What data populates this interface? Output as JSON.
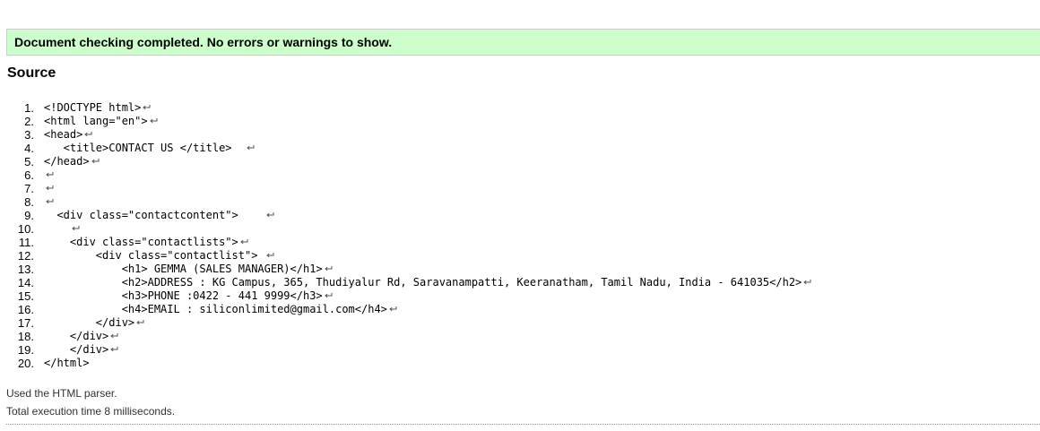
{
  "banner": {
    "message": "Document checking completed. No errors or warnings to show."
  },
  "source": {
    "heading": "Source",
    "lines": [
      {
        "number": "1.",
        "code": "<!DOCTYPE html>",
        "return_mark": true
      },
      {
        "number": "2.",
        "code": "<html lang=\"en\">",
        "return_mark": true
      },
      {
        "number": "3.",
        "code": "<head>",
        "return_mark": true
      },
      {
        "number": "4.",
        "code": "   <title>CONTACT US </title>  ",
        "return_mark": true
      },
      {
        "number": "5.",
        "code": "</head>",
        "return_mark": true
      },
      {
        "number": "6.",
        "code": "",
        "return_mark": true
      },
      {
        "number": "7.",
        "code": "",
        "return_mark": true
      },
      {
        "number": "8.",
        "code": "",
        "return_mark": true
      },
      {
        "number": "9.",
        "code": "  <div class=\"contactcontent\">    ",
        "return_mark": true
      },
      {
        "number": "10.",
        "code": "    ",
        "return_mark": true
      },
      {
        "number": "11.",
        "code": "    <div class=\"contactlists\">",
        "return_mark": true
      },
      {
        "number": "12.",
        "code": "        <div class=\"contactlist\"> ",
        "return_mark": true
      },
      {
        "number": "13.",
        "code": "            <h1> GEMMA (SALES MANAGER)</h1>",
        "return_mark": true
      },
      {
        "number": "14.",
        "code": "            <h2>ADDRESS : KG Campus, 365, Thudiyalur Rd, Saravanampatti, Keeranatham, Tamil Nadu, India - 641035</h2>",
        "return_mark": true
      },
      {
        "number": "15.",
        "code": "            <h3>PHONE :0422 - 441 9999</h3>",
        "return_mark": true
      },
      {
        "number": "16.",
        "code": "            <h4>EMAIL : siliconlimited@gmail.com</h4>",
        "return_mark": true
      },
      {
        "number": "17.",
        "code": "        </div>",
        "return_mark": true
      },
      {
        "number": "18.",
        "code": "    </div>",
        "return_mark": true
      },
      {
        "number": "19.",
        "code": "    </div>",
        "return_mark": true
      },
      {
        "number": "20.",
        "code": "</html>",
        "return_mark": false
      }
    ]
  },
  "footer": {
    "parser_text": "Used the HTML parser.",
    "time_text": "Total execution time 8 milliseconds."
  },
  "icons": {
    "line_end": "return-arrow-icon"
  },
  "colors": {
    "success_background": "#ccffcc",
    "success_border": "#cccccc",
    "return_mark": "#555555"
  }
}
